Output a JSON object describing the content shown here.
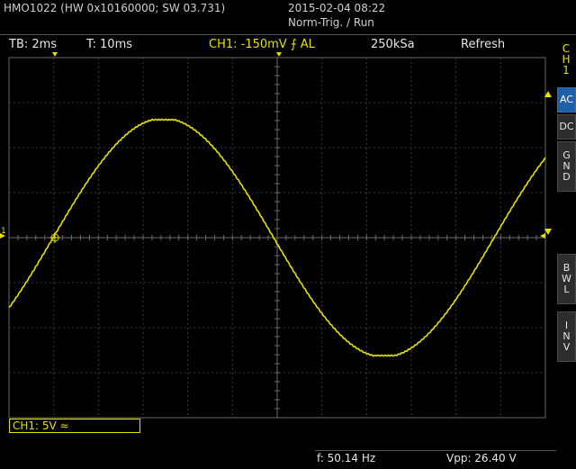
{
  "header": {
    "title": "HMO1022 (HW 0x10160000; SW 03.731)",
    "date": "2015-02-04 08:22",
    "mode": "Norm-Trig. / Run"
  },
  "status": {
    "timebase": "TB: 2ms",
    "trigger_time": "T: 10ms",
    "trigger_info": "CH1: -150mV ⨍ AL",
    "sample_rate": "250kSa",
    "refresh": "Refresh"
  },
  "side": {
    "channel_label": [
      "C",
      "H",
      "1"
    ],
    "ac": "AC",
    "dc": "DC",
    "gnd": [
      "G",
      "N",
      "D"
    ],
    "bwl": [
      "B",
      "W",
      "L"
    ],
    "inv": [
      "I",
      "N",
      "V"
    ]
  },
  "footer": {
    "channel_scale": "CH1: 5V ≈",
    "frequency": "f: 50.14 Hz",
    "vpp": "Vpp: 26.40 V"
  },
  "colors": {
    "trace": "#e8e000",
    "grid": "#3a3a3a",
    "axis": "#6a6a6a",
    "active_button": "#1f5fa8"
  },
  "chart_data": {
    "type": "line",
    "series": [
      {
        "values_desc": "",
        "waveform": "sine",
        "frequency_hz": 50.14,
        "vpp_v": 26.4
      }
    ]
  }
}
